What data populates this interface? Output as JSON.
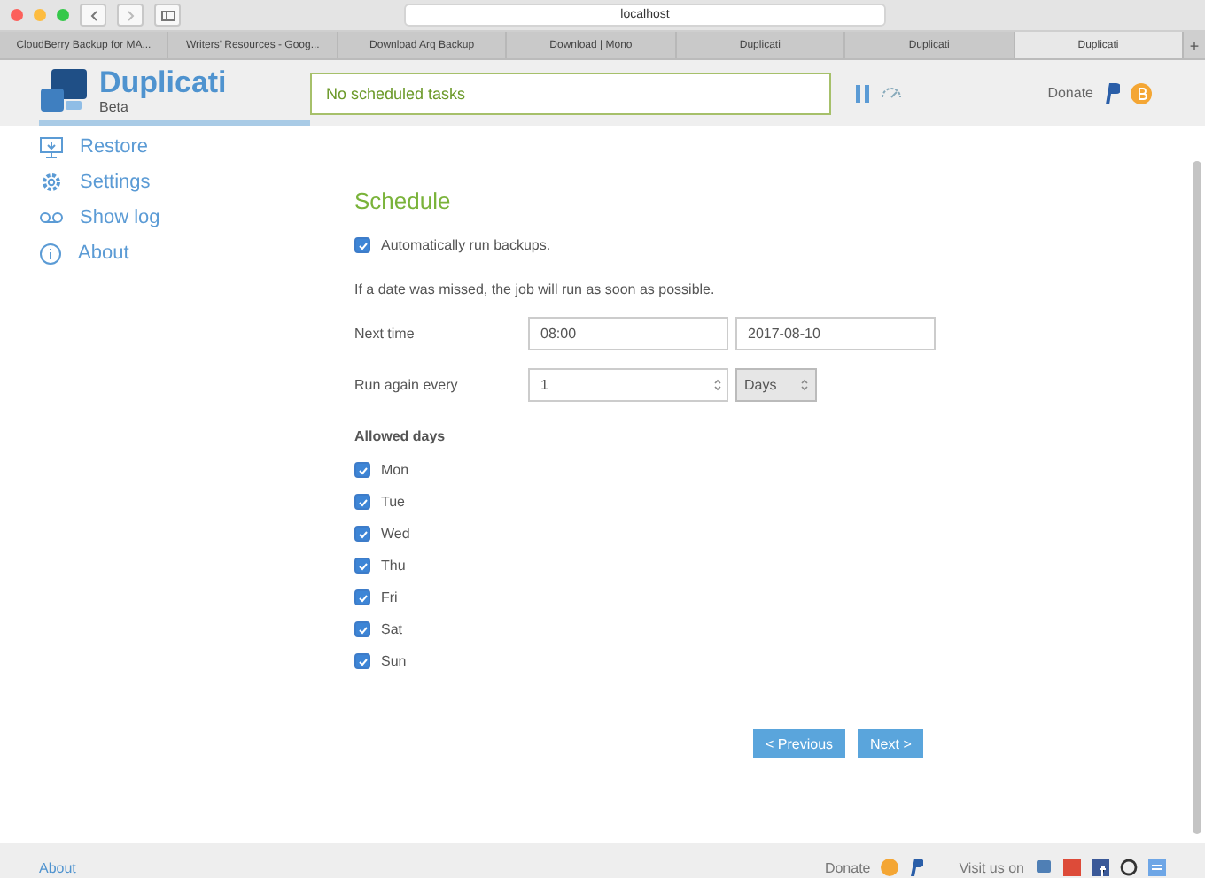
{
  "browser": {
    "address": "localhost",
    "tabs": [
      {
        "label": "CloudBerry Backup for MA...",
        "selected": false
      },
      {
        "label": "Writers' Resources - Goog...",
        "selected": false
      },
      {
        "label": "Download Arq Backup",
        "selected": false
      },
      {
        "label": "Download | Mono",
        "selected": false
      },
      {
        "label": "Duplicati",
        "selected": false
      },
      {
        "label": "Duplicati",
        "selected": false
      },
      {
        "label": "Duplicati",
        "selected": true
      }
    ],
    "new_tab": "+"
  },
  "header": {
    "app_name": "Duplicati",
    "edition": "Beta",
    "status": "No scheduled tasks",
    "donate": "Donate"
  },
  "sidebar": {
    "items": [
      {
        "label": "Restore",
        "kind": "restore"
      },
      {
        "label": "Settings",
        "kind": "settings"
      },
      {
        "label": "Show log",
        "kind": "log"
      },
      {
        "label": "About",
        "kind": "about"
      }
    ]
  },
  "schedule": {
    "title": "Schedule",
    "auto_run": {
      "label": "Automatically run backups.",
      "checked": true
    },
    "note": "If a date was missed, the job will run as soon as possible.",
    "next_time": {
      "label": "Next time",
      "time": "08:00",
      "date": "2017-08-10"
    },
    "run_again": {
      "label": "Run again every",
      "amount": "1",
      "unit": "Days"
    },
    "allowed_days_label": "Allowed days",
    "days": [
      {
        "label": "Mon",
        "checked": true
      },
      {
        "label": "Tue",
        "checked": true
      },
      {
        "label": "Wed",
        "checked": true
      },
      {
        "label": "Thu",
        "checked": true
      },
      {
        "label": "Fri",
        "checked": true
      },
      {
        "label": "Sat",
        "checked": true
      },
      {
        "label": "Sun",
        "checked": true
      }
    ],
    "buttons": {
      "previous": "< Previous",
      "next": "Next >"
    }
  },
  "footer": {
    "about": "About",
    "donate": "Donate",
    "visit": "Visit us on"
  }
}
